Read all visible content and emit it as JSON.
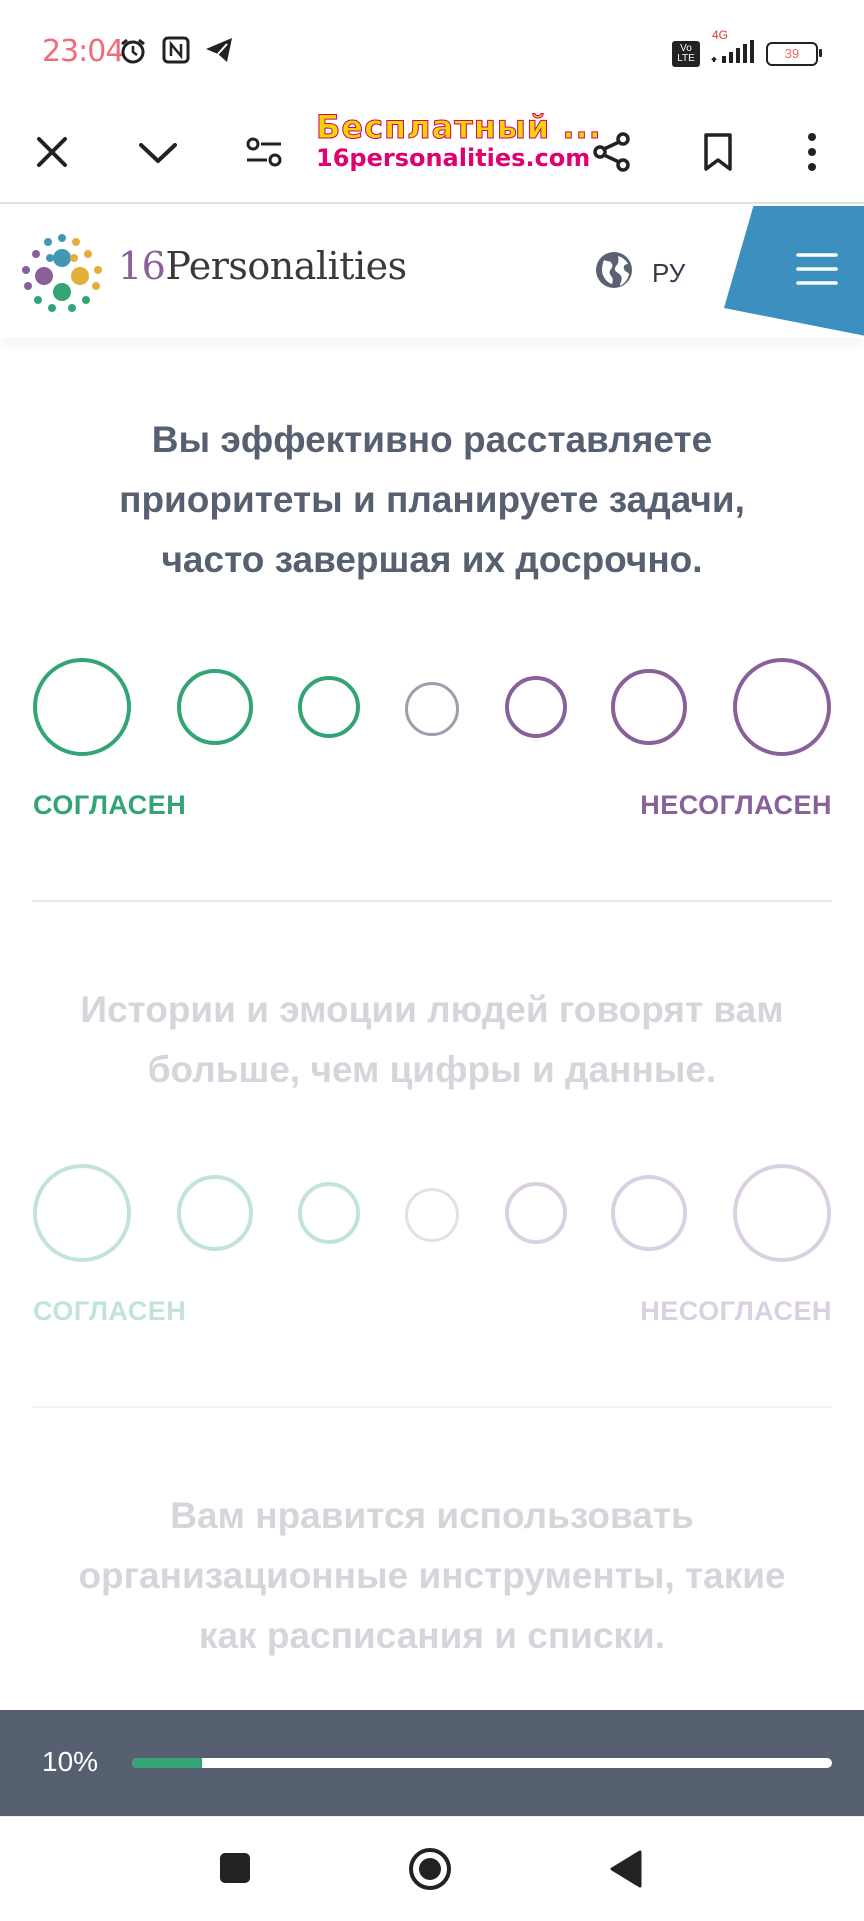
{
  "status_bar": {
    "time": "23:04",
    "network": "4G",
    "volte": "Vo LTE",
    "battery": "39"
  },
  "browser": {
    "title_line1": "Бесплатный ...",
    "title_line2": "16personalities.com"
  },
  "site": {
    "logo_number": "16",
    "logo_word": "Personalities",
    "language": "РУ"
  },
  "questions": [
    {
      "text": "Вы эффективно расставляете приоритеты и планируете задачи, часто завершая их досрочно.",
      "agree_label": "СОГЛАСЕН",
      "disagree_label": "НЕСОГЛАСЕН",
      "active": true
    },
    {
      "text": "Истории и эмоции людей говорят вам больше, чем цифры и данные.",
      "agree_label": "СОГЛАСЕН",
      "disagree_label": "НЕСОГЛАСЕН",
      "active": false
    },
    {
      "text": "Вам нравится использовать организационные инструменты, такие как расписания и списки.",
      "active": false
    }
  ],
  "progress": {
    "label": "10%",
    "value": 0.1
  },
  "colors": {
    "agree": "#33a474",
    "disagree": "#88619a",
    "neutral": "#9b9faa",
    "accent_menu": "#3d8fc0",
    "progress_bg": "#576071"
  }
}
